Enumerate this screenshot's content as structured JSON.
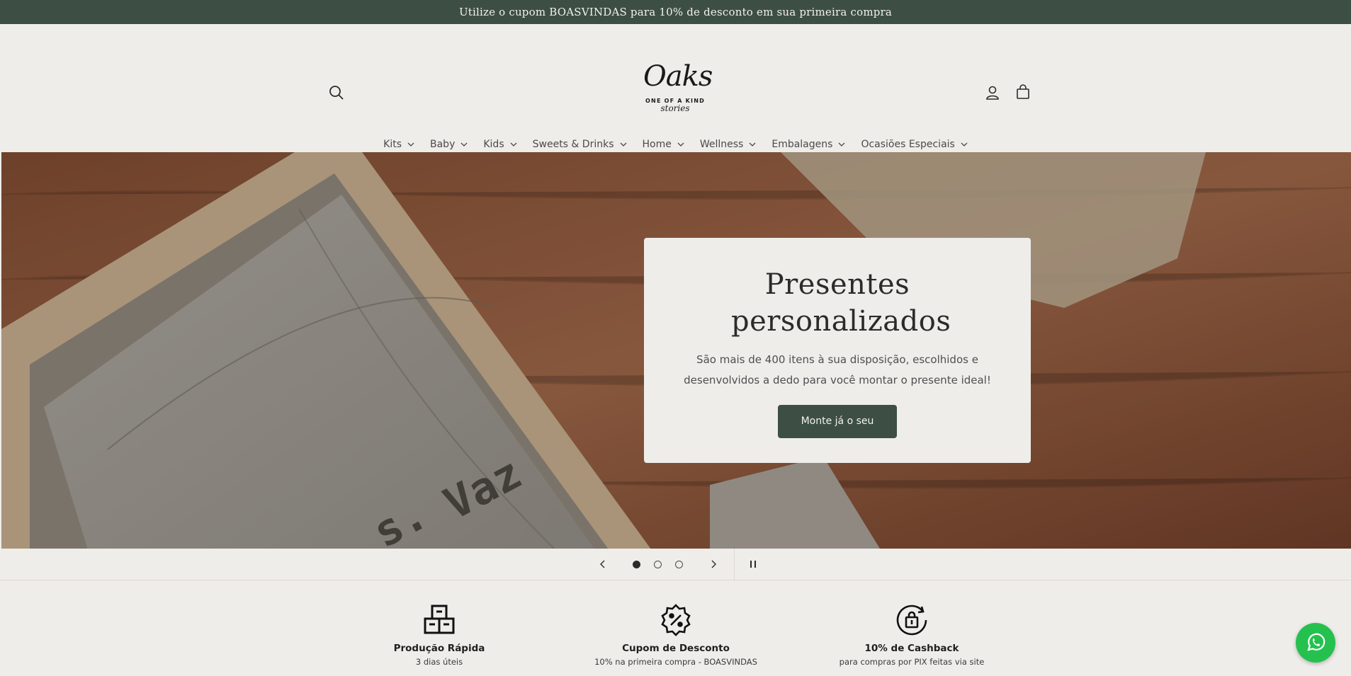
{
  "announcement": {
    "text": "Utilize o cupom BOASVINDAS para 10% de desconto em sua primeira compra"
  },
  "header": {
    "logo": {
      "name": "Oaks",
      "tagline": "ONE OF A KIND",
      "sub": "stories"
    },
    "icons": {
      "search": "search-icon",
      "account": "user-icon",
      "cart": "cart-icon"
    }
  },
  "nav": {
    "items": [
      {
        "label": "Kits"
      },
      {
        "label": "Baby"
      },
      {
        "label": "Kids"
      },
      {
        "label": "Sweets & Drinks"
      },
      {
        "label": "Home"
      },
      {
        "label": "Wellness"
      },
      {
        "label": "Embalagens"
      },
      {
        "label": "Ocasiões Especiais"
      }
    ]
  },
  "hero": {
    "title": "Presentes personalizados",
    "subtitle": "São mais de 400 itens à sua disposição, escolhidos e desenvolvidos a dedo para você montar o presente ideal!",
    "cta": "Monte já o seu",
    "slides_total": 3,
    "active_slide": 1
  },
  "features": [
    {
      "icon": "boxes-icon",
      "title": "Produção Rápida",
      "subtitle": "3 dias úteis"
    },
    {
      "icon": "discount-badge-icon",
      "title": "Cupom de Desconto",
      "subtitle": "10% na primeira compra - BOASVINDAS"
    },
    {
      "icon": "cashback-bag-icon",
      "title": "10% de Cashback",
      "subtitle": "para compras por PIX feitas via site"
    }
  ],
  "colors": {
    "brand_green": "#3d4f44",
    "background": "#efedea",
    "whatsapp": "#25c14f"
  }
}
